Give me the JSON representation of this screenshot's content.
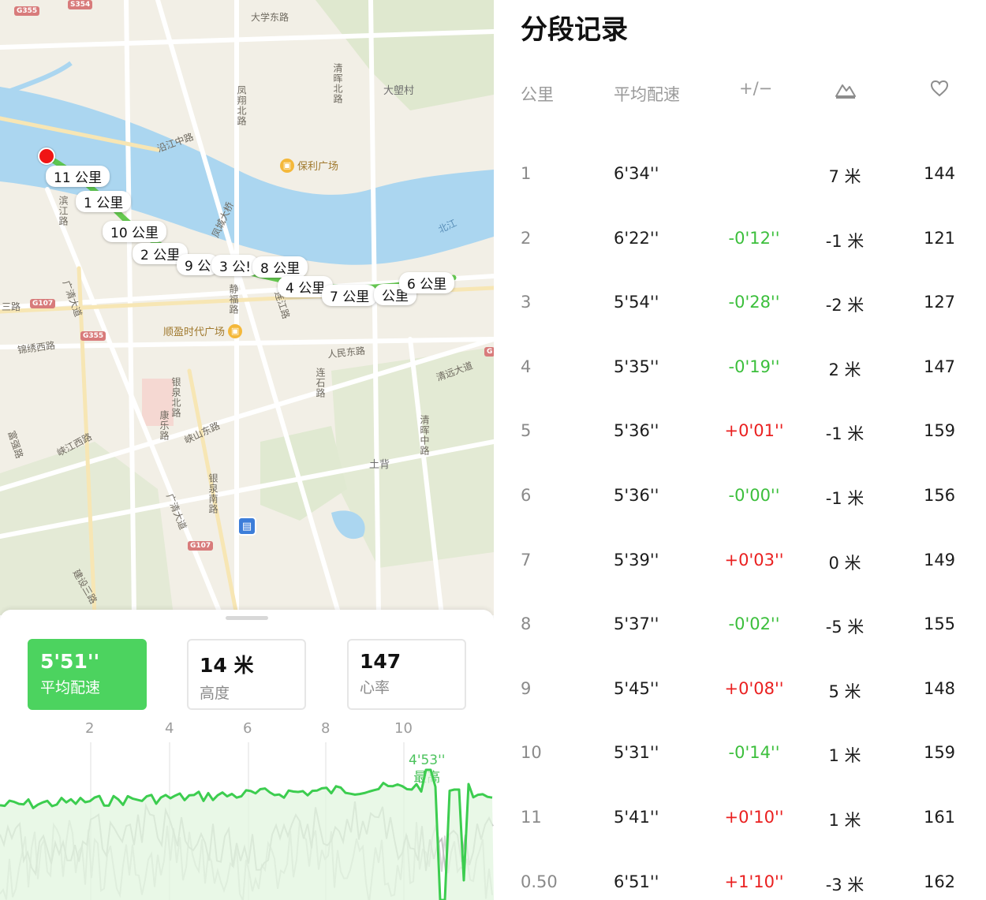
{
  "map": {
    "road_labels": [
      {
        "text": "大学东路",
        "vertical": false
      },
      {
        "text": "凤翔北路",
        "vertical": true
      },
      {
        "text": "清晖北路",
        "vertical": true
      },
      {
        "text": "沿江中路",
        "vertical": false
      },
      {
        "text": "凤城大桥",
        "vertical": false
      },
      {
        "text": "滨江路",
        "vertical": true
      },
      {
        "text": "广清大道",
        "vertical": false
      },
      {
        "text": "静福路",
        "vertical": true
      },
      {
        "text": "锦绣西路",
        "vertical": false
      },
      {
        "text": "人民东路",
        "vertical": false
      },
      {
        "text": "清远大道",
        "vertical": false
      },
      {
        "text": "连江路",
        "vertical": false
      },
      {
        "text": "银泉北路",
        "vertical": true
      },
      {
        "text": "连石路",
        "vertical": true
      },
      {
        "text": "峡江西路",
        "vertical": false
      },
      {
        "text": "峡山东路",
        "vertical": false
      },
      {
        "text": "康乐路",
        "vertical": true
      },
      {
        "text": "清晖中路",
        "vertical": true
      },
      {
        "text": "富强路",
        "vertical": false
      },
      {
        "text": "银泉南路",
        "vertical": true
      },
      {
        "text": "广清大道",
        "vertical": false
      },
      {
        "text": "建设三路",
        "vertical": false
      },
      {
        "text": "北江",
        "vertical": false
      },
      {
        "text": "三路",
        "vertical": false
      }
    ],
    "places": [
      "大塱村",
      "土背"
    ],
    "pois": [
      {
        "name": "保利广场"
      },
      {
        "name": "顺盈时代广场"
      }
    ],
    "shields": [
      "G355",
      "S354",
      "G107",
      "G355",
      "G107",
      "G"
    ],
    "km_markers": [
      "11 公里",
      "1 公里",
      "10 公里",
      "2 公里",
      "9 公",
      "3 公!",
      "8 公里",
      "4 公里",
      "7 公里",
      "公里",
      "6 公里"
    ]
  },
  "stats": {
    "pace": {
      "value": "5'51''",
      "label": "平均配速"
    },
    "elevation": {
      "value": "14 米",
      "label": "高度"
    },
    "heart_rate": {
      "value": "147",
      "label": "心率"
    }
  },
  "chart_axis": [
    "2",
    "4",
    "6",
    "8",
    "10"
  ],
  "chart_peak": {
    "value": "4'53''",
    "label": "最高"
  },
  "chart_data": {
    "type": "line",
    "xlabel": "",
    "ylabel": "",
    "x_ticks": [
      "2",
      "4",
      "6",
      "8",
      "10"
    ],
    "series": [
      {
        "name": "平均配速",
        "color": "#3ccd4f"
      },
      {
        "name": "高度",
        "color": "#bdbdbd"
      },
      {
        "name": "心率",
        "color": "#d3d3d3"
      }
    ],
    "annotation": {
      "text": "4'53''",
      "label": "最高"
    }
  },
  "splits": {
    "title": "分段记录",
    "headers": {
      "km": "公里",
      "pace": "平均配速",
      "diff": "+/−",
      "elev_icon": "mountain-icon",
      "hr_icon": "heart-icon"
    },
    "rows": [
      {
        "km": "1",
        "pace": "6'34''",
        "diff": "",
        "elev": "7 米",
        "hr": "144",
        "dir": "none"
      },
      {
        "km": "2",
        "pace": "6'22''",
        "diff": "-0'12''",
        "elev": "-1 米",
        "hr": "121",
        "dir": "faster"
      },
      {
        "km": "3",
        "pace": "5'54''",
        "diff": "-0'28''",
        "elev": "-2 米",
        "hr": "127",
        "dir": "faster"
      },
      {
        "km": "4",
        "pace": "5'35''",
        "diff": "-0'19''",
        "elev": "2 米",
        "hr": "147",
        "dir": "faster"
      },
      {
        "km": "5",
        "pace": "5'36''",
        "diff": "+0'01''",
        "elev": "-1 米",
        "hr": "159",
        "dir": "slower"
      },
      {
        "km": "6",
        "pace": "5'36''",
        "diff": "-0'00''",
        "elev": "-1 米",
        "hr": "156",
        "dir": "faster"
      },
      {
        "km": "7",
        "pace": "5'39''",
        "diff": "+0'03''",
        "elev": "0 米",
        "hr": "149",
        "dir": "slower"
      },
      {
        "km": "8",
        "pace": "5'37''",
        "diff": "-0'02''",
        "elev": "-5 米",
        "hr": "155",
        "dir": "faster"
      },
      {
        "km": "9",
        "pace": "5'45''",
        "diff": "+0'08''",
        "elev": "5 米",
        "hr": "148",
        "dir": "slower"
      },
      {
        "km": "10",
        "pace": "5'31''",
        "diff": "-0'14''",
        "elev": "1 米",
        "hr": "159",
        "dir": "faster"
      },
      {
        "km": "11",
        "pace": "5'41''",
        "diff": "+0'10''",
        "elev": "1 米",
        "hr": "161",
        "dir": "slower"
      },
      {
        "km": "0.50",
        "pace": "6'51''",
        "diff": "+1'10''",
        "elev": "-3 米",
        "hr": "162",
        "dir": "slower"
      }
    ]
  },
  "colors": {
    "accent_green": "#4cd35f",
    "faster": "#3cbf3c",
    "slower": "#ea2020",
    "river": "#abd6f0"
  }
}
